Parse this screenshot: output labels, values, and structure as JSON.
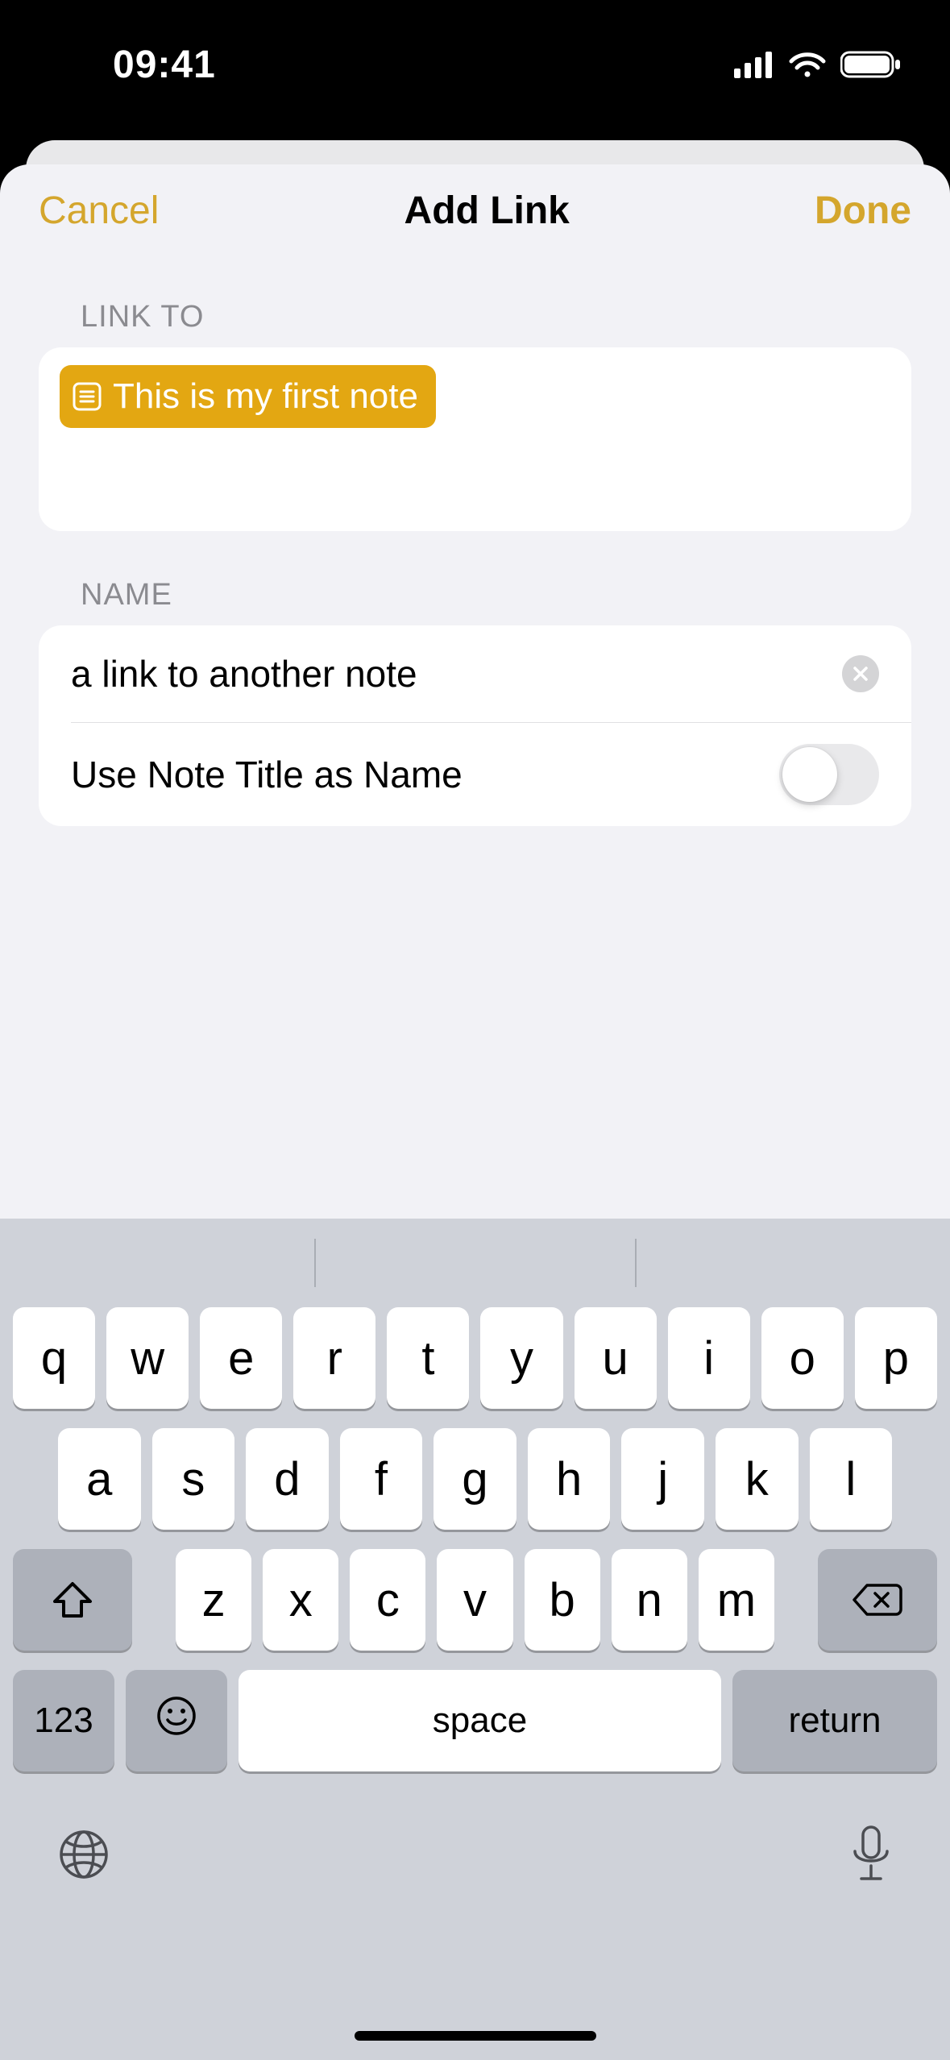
{
  "status": {
    "time": "09:41"
  },
  "nav": {
    "cancel": "Cancel",
    "title": "Add Link",
    "done": "Done"
  },
  "sections": {
    "link_to": "LINK TO",
    "name": "NAME"
  },
  "linkto": {
    "selected_note": "This is my first note"
  },
  "name_row": {
    "value": "a link to another note"
  },
  "toggle_row": {
    "label": "Use Note Title as Name",
    "on": false
  },
  "keyboard": {
    "row1": [
      "q",
      "w",
      "e",
      "r",
      "t",
      "y",
      "u",
      "i",
      "o",
      "p"
    ],
    "row2": [
      "a",
      "s",
      "d",
      "f",
      "g",
      "h",
      "j",
      "k",
      "l"
    ],
    "row3": [
      "z",
      "x",
      "c",
      "v",
      "b",
      "n",
      "m"
    ],
    "space": "space",
    "return": "return",
    "numeric": "123"
  }
}
